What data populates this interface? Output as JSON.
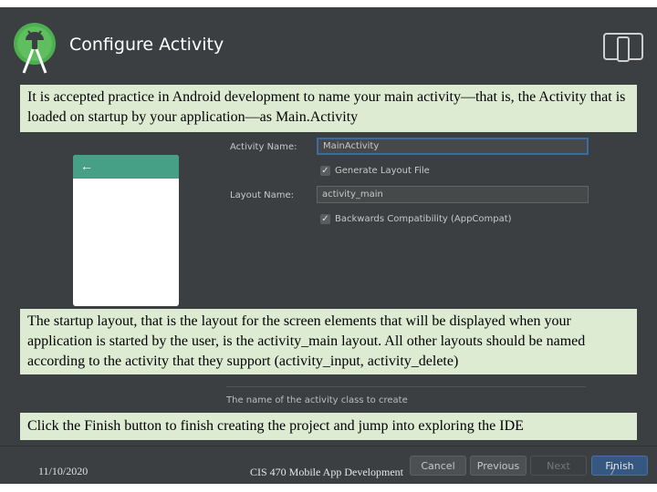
{
  "header": {
    "title": "Configure Activity",
    "logo_icon": "android-studio-logo-icon",
    "device_icon": "device-preview-icon"
  },
  "notes": {
    "intro": "It is accepted practice in Android development to name your main activity—that is, the Activity that is loaded on startup by your application—as Main.Activity",
    "layout": "The startup layout, that is the layout for the screen elements that will be displayed when your application is started by the user, is the activity_main layout. All other layouts should be named according to the activity that they support (activity_input, activity_delete)",
    "finish": "Click the Finish button to finish creating the project and jump into exploring the IDE"
  },
  "preview": {
    "back_icon": "back-arrow-icon",
    "back_glyph": "←",
    "toolbar_color": "#45a085"
  },
  "form": {
    "activity_name_label": "Activity Name:",
    "activity_name_value": "MainActivity",
    "generate_layout_label": "Generate Layout File",
    "generate_layout_checked": true,
    "layout_name_label": "Layout Name:",
    "layout_name_value": "activity_main",
    "backwards_compat_label": "Backwards Compatibility (AppCompat)",
    "backwards_compat_checked": true,
    "check_glyph": "✓",
    "hint": "The name of the activity class to create"
  },
  "buttons": {
    "cancel": "Cancel",
    "previous": "Previous",
    "next": "Next",
    "finish": "Finish"
  },
  "footer": {
    "date": "11/10/2020",
    "course": "CIS 470 Mobile App Development",
    "page": "7"
  },
  "colors": {
    "dialog_bg": "#3c3f41",
    "note_bg": "#dcebd2",
    "focus_border": "#3e6aa3"
  }
}
